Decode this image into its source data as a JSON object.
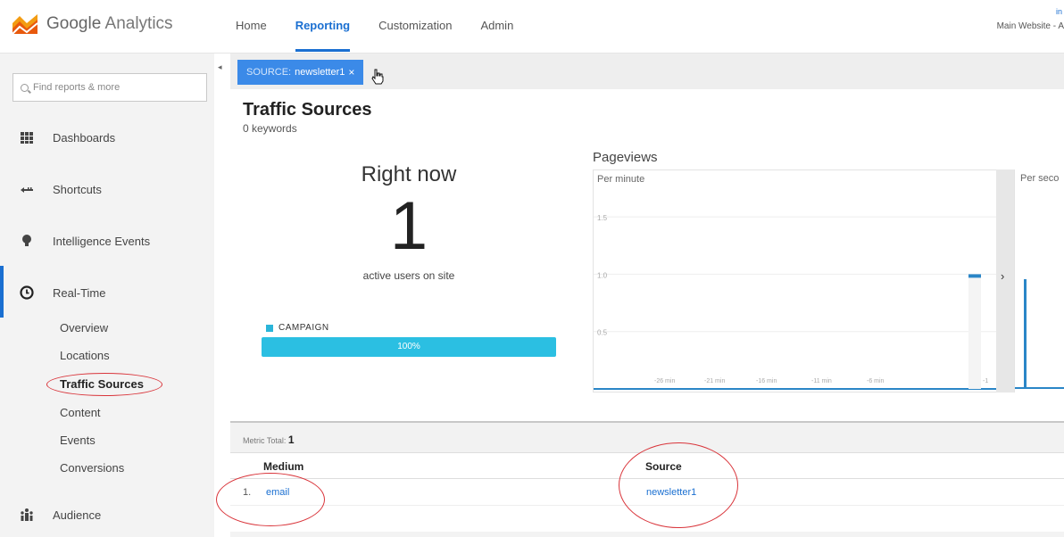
{
  "app": {
    "logo_brand": "Google",
    "logo_product": "Analytics"
  },
  "nav": {
    "items": [
      {
        "label": "Home",
        "active": false
      },
      {
        "label": "Reporting",
        "active": true
      },
      {
        "label": "Customization",
        "active": false
      },
      {
        "label": "Admin",
        "active": false
      }
    ]
  },
  "account": {
    "line1": "in",
    "line2": "Main Website - A"
  },
  "sidebar": {
    "search_placeholder": "Find reports & more",
    "items": [
      {
        "label": "Dashboards",
        "icon": "dashboards-icon"
      },
      {
        "label": "Shortcuts",
        "icon": "shortcuts-icon"
      },
      {
        "label": "Intelligence Events",
        "icon": "lightbulb-icon"
      },
      {
        "label": "Real-Time",
        "icon": "clock-icon",
        "active": true
      },
      {
        "label": "Audience",
        "icon": "audience-icon"
      }
    ],
    "realtime_sub": [
      "Overview",
      "Locations",
      "Traffic Sources",
      "Content",
      "Events",
      "Conversions"
    ],
    "selected_sub": "Traffic Sources"
  },
  "filter": {
    "key": "SOURCE:",
    "value": "newsletter1",
    "remove_glyph": "×"
  },
  "page": {
    "title": "Traffic Sources",
    "subtitle": "0 keywords"
  },
  "right_now": {
    "title": "Right now",
    "count": "1",
    "label": "active users on site",
    "legend": "CAMPAIGN",
    "bar_label": "100%",
    "bar_fraction": 1.0
  },
  "pageviews": {
    "title": "Pageviews",
    "per_minute_label": "Per minute",
    "per_second_label": "Per seco",
    "expand_glyph": "›"
  },
  "chart_data": {
    "type": "bar",
    "title": "Per minute",
    "y_ticks": [
      "1.5",
      "1.0",
      "0.5"
    ],
    "x_ticks": [
      "-26 min",
      "-21 min",
      "-16 min",
      "-11 min",
      "-6 min",
      "-1"
    ],
    "ylim": [
      0,
      1.75
    ],
    "x": [
      -30,
      -1
    ],
    "values": [
      0,
      1
    ],
    "grid": true
  },
  "metrics": {
    "label": "Metric Total:",
    "total": "1"
  },
  "table": {
    "headers": [
      "Medium",
      "Source"
    ],
    "rows": [
      {
        "num": "1.",
        "medium": "email",
        "source": "newsletter1"
      }
    ]
  },
  "colors": {
    "accent": "#1a6fd1",
    "chip": "#3b8ae8",
    "campaign": "#2bbfe2",
    "annotation": "#d9343a"
  }
}
